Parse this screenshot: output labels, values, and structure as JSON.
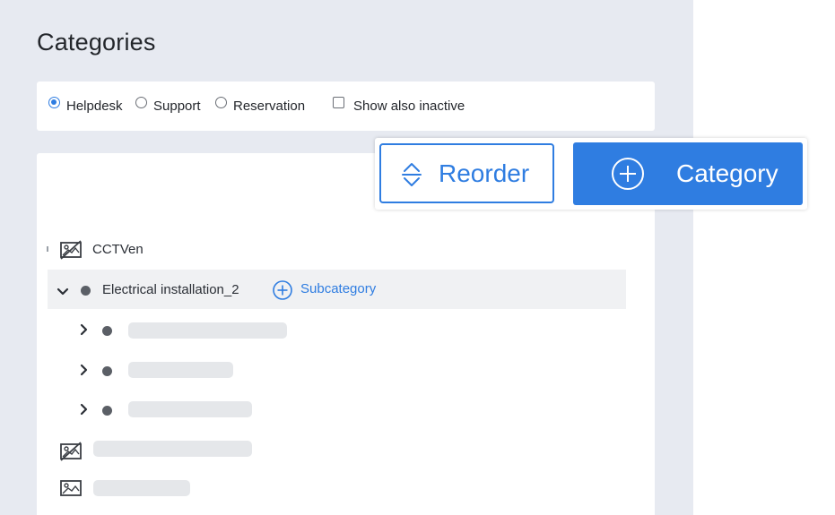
{
  "page": {
    "title": "Categories"
  },
  "filters": {
    "options": [
      {
        "label": "Helpdesk",
        "checked": true
      },
      {
        "label": "Support",
        "checked": false
      },
      {
        "label": "Reservation",
        "checked": false
      }
    ],
    "show_inactive_label": "Show also inactive",
    "show_inactive_checked": false
  },
  "toolbar": {
    "reorder_label": "Reorder",
    "category_label": "Category"
  },
  "tree": {
    "items": [
      {
        "label": "CCTVen",
        "icon": "image-off-icon"
      },
      {
        "label": "Electrical installation_2",
        "expanded": true,
        "add_label": "Subcategory"
      }
    ]
  },
  "colors": {
    "accent": "#2f7de1",
    "page_background": "#e7eaf1",
    "row_highlight": "#f0f1f3",
    "skeleton": "#e5e7ea"
  }
}
